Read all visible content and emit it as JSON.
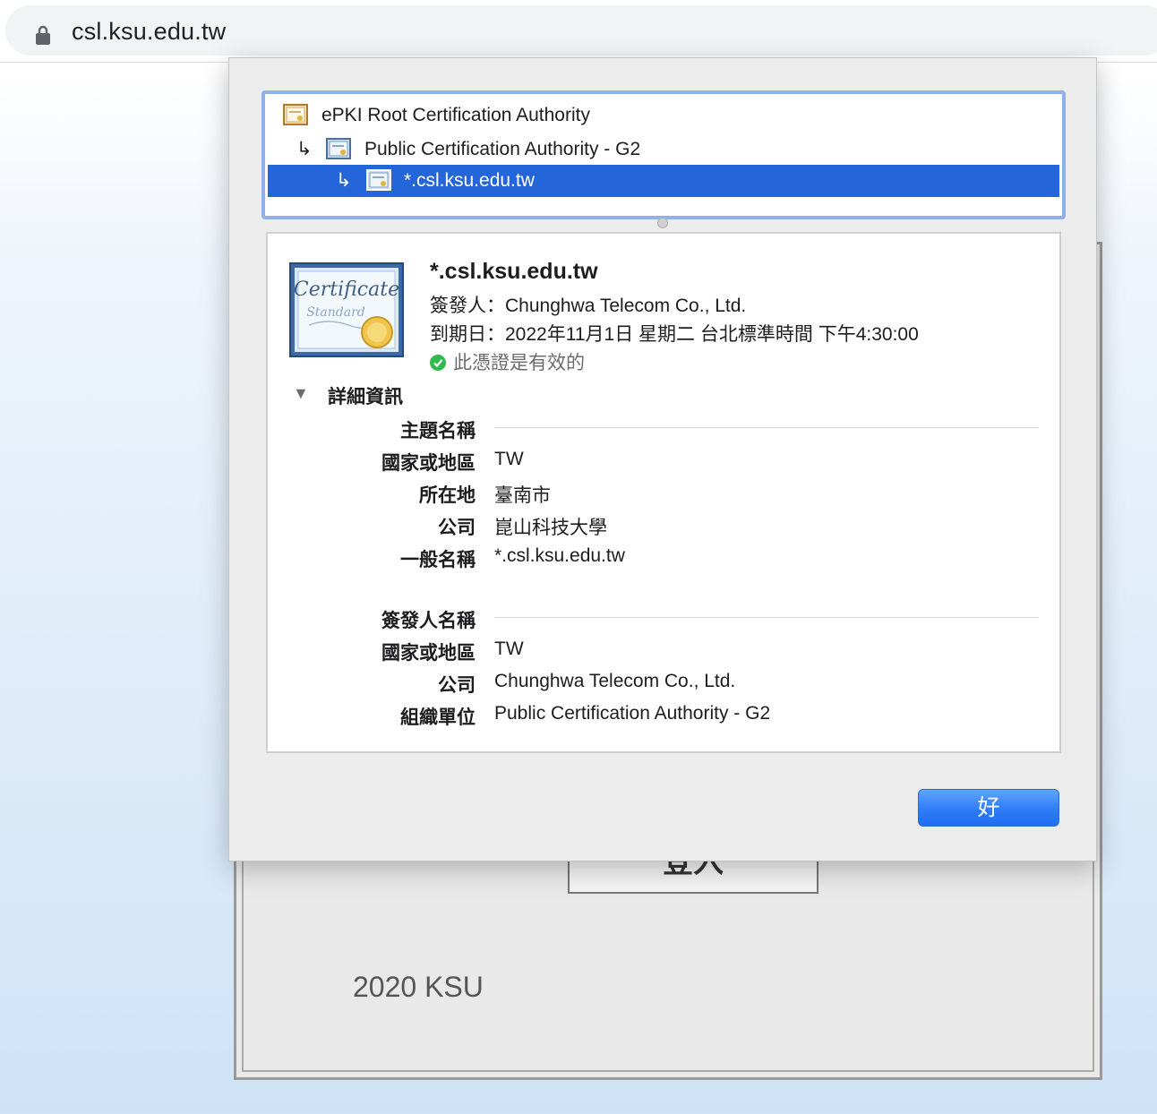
{
  "browser": {
    "url": "csl.ksu.edu.tw",
    "lock_icon": "lock-icon"
  },
  "background_page": {
    "login_button_label": "登入",
    "footer": "2020 KSU"
  },
  "certificate_chain": [
    {
      "label": "ePKI Root Certification Authority",
      "icon": "root-certificate-icon",
      "selected": false
    },
    {
      "label": "Public Certification Authority - G2",
      "icon": "certificate-icon",
      "selected": false
    },
    {
      "label": "*.csl.ksu.edu.tw",
      "icon": "certificate-icon",
      "selected": true
    }
  ],
  "certificate": {
    "title": "*.csl.ksu.edu.tw",
    "issuer_line": "簽發人：Chunghwa Telecom Co., Ltd.",
    "expires_line": "到期日：2022年11月1日 星期二 台北標準時間 下午4:30:00",
    "validity": "此憑證是有效的",
    "badge_text_1": "Certificate",
    "badge_text_2": "Standard"
  },
  "details": {
    "heading": "詳細資訊",
    "subject": {
      "heading": "主題名稱",
      "fields": [
        {
          "label": "國家或地區",
          "value": "TW"
        },
        {
          "label": "所在地",
          "value": "臺南市"
        },
        {
          "label": "公司",
          "value": "崑山科技大學"
        },
        {
          "label": "一般名稱",
          "value": "*.csl.ksu.edu.tw"
        }
      ]
    },
    "issuer": {
      "heading": "簽發人名稱",
      "fields": [
        {
          "label": "國家或地區",
          "value": "TW"
        },
        {
          "label": "公司",
          "value": "Chunghwa Telecom Co., Ltd."
        },
        {
          "label": "組織單位",
          "value": "Public Certification Authority - G2"
        }
      ]
    }
  },
  "ok_button_label": "好",
  "colors": {
    "selection": "#2466d9",
    "ok_button": "#2e7cf6",
    "valid_check": "#30b94d"
  }
}
